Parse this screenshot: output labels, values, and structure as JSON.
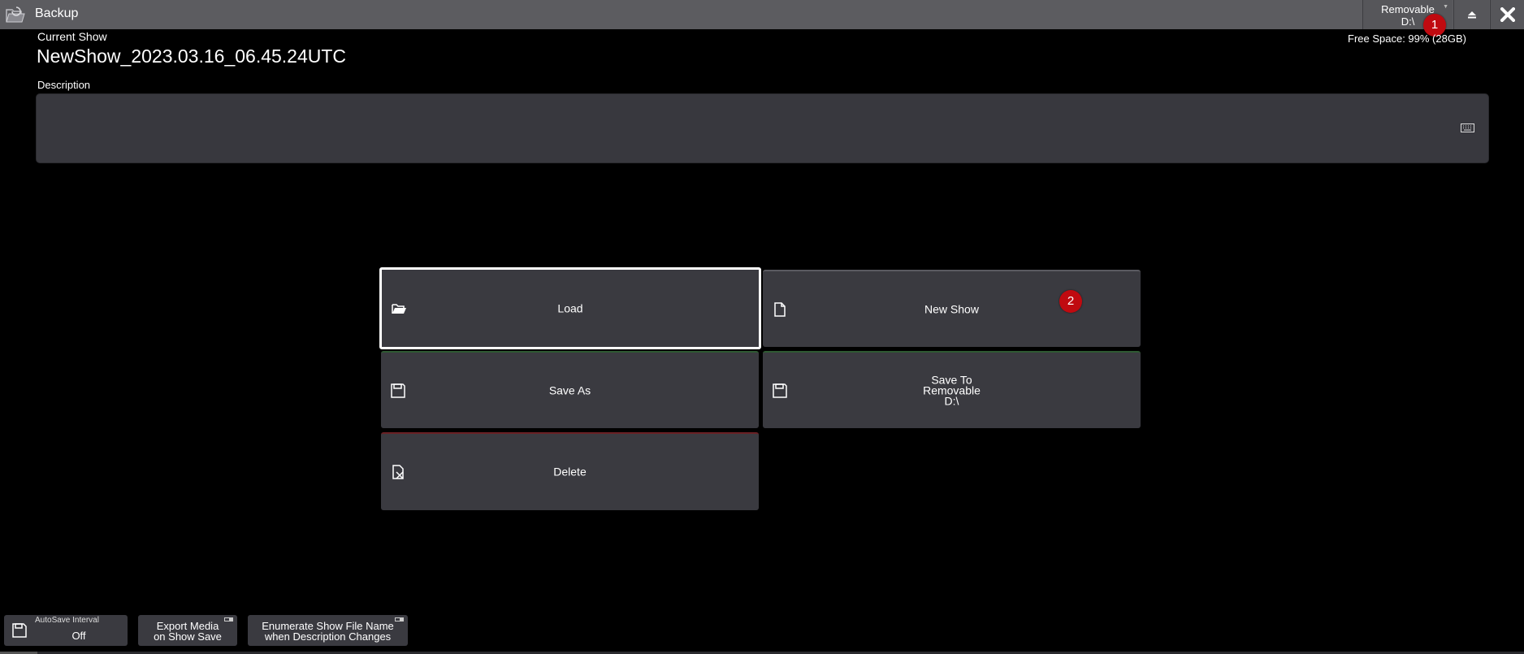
{
  "titlebar": {
    "title": "Backup",
    "drive": {
      "line1": "Removable",
      "line2": "D:\\"
    },
    "badge1": "1"
  },
  "header": {
    "current_show_label": "Current Show",
    "show_name": "NewShow_2023.03.16_06.45.24UTC",
    "free_space": "Free Space: 99% (28GB)",
    "description_label": "Description",
    "description_value": ""
  },
  "actions": {
    "load": "Load",
    "new_show": "New Show",
    "new_show_badge": "2",
    "save_as": "Save As",
    "save_to": "Save To\nRemovable\nD:\\",
    "delete": "Delete"
  },
  "bottom": {
    "autosave_caption": "AutoSave Interval",
    "autosave_value": "Off",
    "export_media": "Export Media\non Show Save",
    "enumerate": "Enumerate Show File Name\nwhen Description Changes"
  },
  "colors": {
    "badge": "#c00a10",
    "button_bg": "#3a3a40",
    "titlebar_bg": "#5c5c60"
  },
  "icons": [
    "folder-backup-icon",
    "keyboard-icon",
    "eject-icon",
    "close-icon",
    "folder-open-icon",
    "document-icon",
    "save-disk-icon",
    "delete-document-icon"
  ]
}
